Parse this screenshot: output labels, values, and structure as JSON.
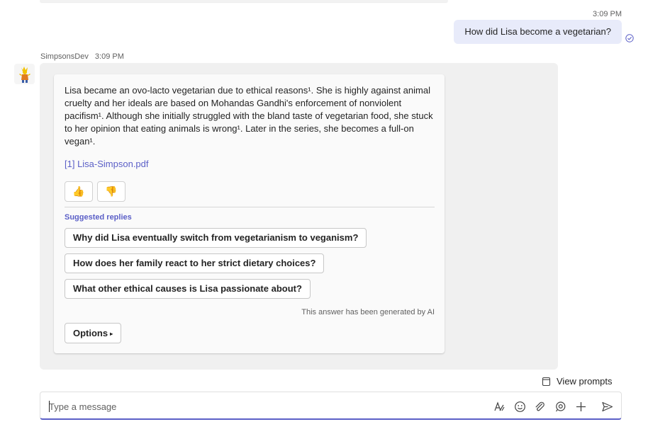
{
  "user_message": {
    "time": "3:09 PM",
    "text": "How did Lisa become a vegetarian?",
    "status_icon": "read-check-icon"
  },
  "bot_message": {
    "sender": "SimpsonsDev",
    "time": "3:09 PM",
    "avatar_icon": "bot-avatar-icon",
    "answer": "Lisa became an ovo-lacto vegetarian due to ethical reasons¹. She is highly against animal cruelty and her ideals are based on Mohandas Gandhi's enforcement of nonviolent pacifism¹. Although she initially struggled with the bland taste of vegetarian food, she stuck to her opinion that eating animals is wrong¹. Later in the series, she becomes a full-on vegan¹.",
    "citation": "[1] Lisa-Simpson.pdf",
    "thumbs_up": "👍",
    "thumbs_down": "👎",
    "suggested_title": "Suggested replies",
    "suggestions": [
      "Why did Lisa eventually switch from vegetarianism to veganism?",
      "How does her family react to her strict dietary choices?",
      "What other ethical causes is Lisa passionate about?"
    ],
    "ai_note": "This answer has been generated by AI",
    "options_label": "Options",
    "options_caret": "▸"
  },
  "view_prompts": {
    "label": "View prompts",
    "icon": "prompts-icon"
  },
  "composer": {
    "placeholder": "Type a message",
    "tools": [
      "format-icon",
      "emoji-icon",
      "attach-icon",
      "loop-icon",
      "add-icon",
      "send-icon"
    ]
  },
  "colors": {
    "accent": "#5b5fc7",
    "user_bubble": "#e8ebfa",
    "bot_bubble": "#f0f0f0"
  }
}
